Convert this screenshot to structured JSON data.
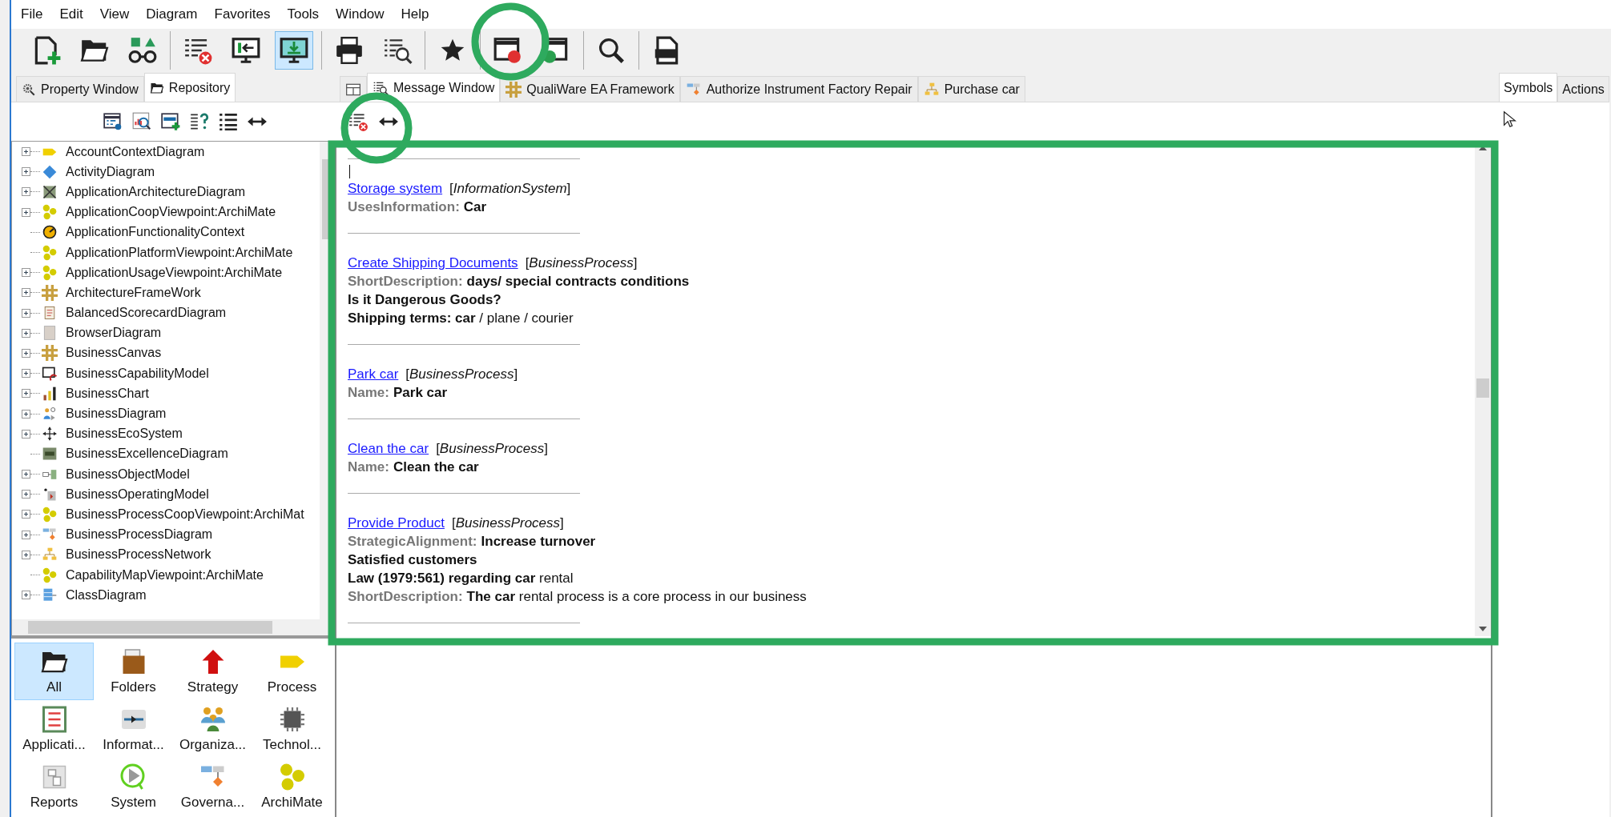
{
  "menu": [
    "File",
    "Edit",
    "View",
    "Diagram",
    "Favorites",
    "Tools",
    "Window",
    "Help"
  ],
  "toolbar": {
    "groups": [
      [
        {
          "pressed": false
        },
        {
          "pressed": false
        },
        {
          "pressed": false
        }
      ],
      [
        {
          "pressed": false
        },
        {
          "pressed": false
        },
        {
          "pressed": true
        }
      ],
      [
        {
          "pressed": false
        },
        {
          "pressed": false
        }
      ],
      [
        {
          "pressed": false
        }
      ],
      [
        {
          "pressed": false
        },
        {
          "pressed": false
        }
      ],
      [
        {
          "pressed": false
        }
      ],
      [
        {
          "pressed": false
        }
      ]
    ]
  },
  "left_panel": {
    "tabs": [
      {
        "label": "Property Window",
        "selected": false
      },
      {
        "label": "Repository",
        "selected": true
      }
    ],
    "tree": [
      {
        "label": "AccountContextDiagram",
        "expandable": true
      },
      {
        "label": "ActivityDiagram",
        "expandable": true
      },
      {
        "label": "ApplicationArchitectureDiagram",
        "expandable": true
      },
      {
        "label": "ApplicationCoopViewpoint:ArchiMate",
        "expandable": true
      },
      {
        "label": "ApplicationFunctionalityContext",
        "expandable": false
      },
      {
        "label": "ApplicationPlatformViewpoint:ArchiMate",
        "expandable": false
      },
      {
        "label": "ApplicationUsageViewpoint:ArchiMate",
        "expandable": true
      },
      {
        "label": "ArchitectureFrameWork",
        "expandable": true
      },
      {
        "label": "BalancedScorecardDiagram",
        "expandable": true
      },
      {
        "label": "BrowserDiagram",
        "expandable": true
      },
      {
        "label": "BusinessCanvas",
        "expandable": true
      },
      {
        "label": "BusinessCapabilityModel",
        "expandable": true
      },
      {
        "label": "BusinessChart",
        "expandable": true
      },
      {
        "label": "BusinessDiagram",
        "expandable": true
      },
      {
        "label": "BusinessEcoSystem",
        "expandable": true
      },
      {
        "label": "BusinessExcellenceDiagram",
        "expandable": false
      },
      {
        "label": "BusinessObjectModel",
        "expandable": true
      },
      {
        "label": "BusinessOperatingModel",
        "expandable": true
      },
      {
        "label": "BusinessProcessCoopViewpoint:ArchiMat",
        "expandable": true
      },
      {
        "label": "BusinessProcessDiagram",
        "expandable": true
      },
      {
        "label": "BusinessProcessNetwork",
        "expandable": true
      },
      {
        "label": "CapabilityMapViewpoint:ArchiMate",
        "expandable": false
      },
      {
        "label": "ClassDiagram",
        "expandable": true
      }
    ],
    "palette": [
      {
        "label": "All",
        "selected": true
      },
      {
        "label": "Folders",
        "selected": false
      },
      {
        "label": "Strategy",
        "selected": false
      },
      {
        "label": "Process",
        "selected": false
      },
      {
        "label": "Applicati...",
        "selected": false
      },
      {
        "label": "Informat...",
        "selected": false
      },
      {
        "label": "Organiza...",
        "selected": false
      },
      {
        "label": "Technol...",
        "selected": false
      },
      {
        "label": "Reports",
        "selected": false
      },
      {
        "label": "System",
        "selected": false
      },
      {
        "label": "Governa...",
        "selected": false
      },
      {
        "label": "ArchiMate",
        "selected": false
      }
    ]
  },
  "center": {
    "tabs": [
      {
        "kind": "icon",
        "selected": false
      },
      {
        "kind": "text",
        "label": "Message Window",
        "selected": true
      },
      {
        "kind": "text",
        "label": "QualiWare EA Framework",
        "selected": false
      },
      {
        "kind": "text",
        "label": "Authorize Instrument Factory Repair",
        "selected": false
      },
      {
        "kind": "text",
        "label": "Purchase car",
        "selected": false
      }
    ],
    "entries": [
      {
        "title": "Storage system",
        "type": "[*InformationSystem*]",
        "lines": [
          {
            "label": "UsesInformation:",
            "kind": "bold",
            "value": "Car"
          }
        ]
      },
      {
        "title": "Create Shipping Documents",
        "type": "[*BusinessProcess*]",
        "lines": [
          {
            "label": "ShortDescription:",
            "kind": "bold",
            "value": "days/ special contracts conditions"
          },
          {
            "kind": "bold",
            "value": "Is it Dangerous Goods?"
          },
          {
            "kind": "mixed",
            "value": "**Shipping terms: car** / plane / courier"
          }
        ]
      },
      {
        "title": "Park car",
        "type": "[*BusinessProcess*]",
        "lines": [
          {
            "label": "Name:",
            "kind": "bold",
            "value": "Park car"
          }
        ]
      },
      {
        "title": "Clean the car",
        "type": "[*BusinessProcess*]",
        "lines": [
          {
            "label": "Name:",
            "kind": "bold",
            "value": "Clean the car"
          }
        ]
      },
      {
        "title": "Provide Product",
        "type": "[*BusinessProcess*]",
        "lines": [
          {
            "label": "StrategicAlignment:",
            "kind": "bold",
            "value": "Increase turnover"
          },
          {
            "kind": "bold",
            "value": "Satisfied customers"
          },
          {
            "kind": "mixed",
            "value": "**Law (1979:561) regarding car** rental"
          },
          {
            "label": "ShortDescription:",
            "kind": "mixed",
            "value": "**The car** rental process is a core process in our business"
          }
        ]
      }
    ]
  },
  "right_panel": {
    "tabs": [
      {
        "label": "Symbols",
        "selected": true
      },
      {
        "label": "Actions",
        "selected": false
      }
    ]
  },
  "annotations": [
    {
      "kind": "ring"
    },
    {
      "kind": "ring"
    },
    {
      "kind": "frame"
    }
  ]
}
